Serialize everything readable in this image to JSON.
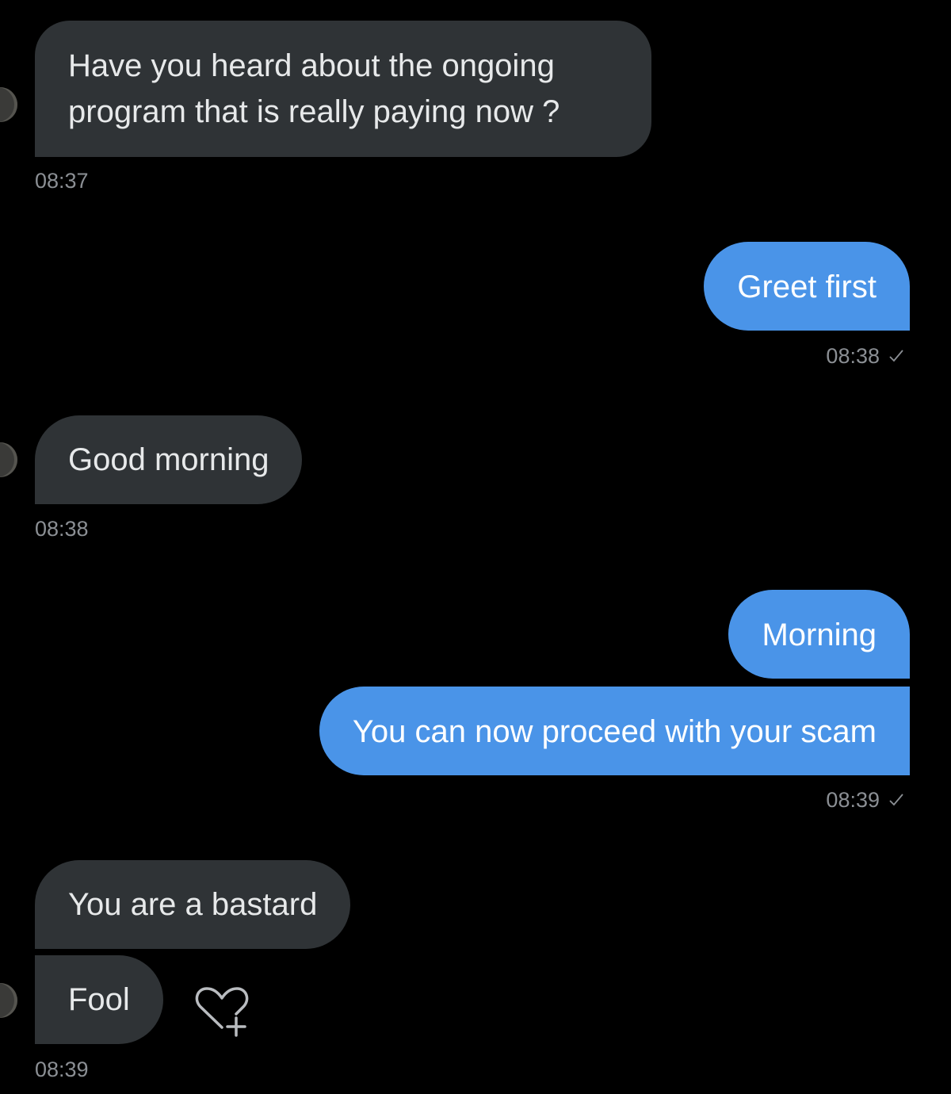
{
  "conversation": {
    "messages": [
      {
        "id": "m1",
        "direction": "incoming",
        "lines": [
          "Have you heard about the ongoing",
          "program that is really paying now ?"
        ]
      },
      {
        "id": "m2",
        "direction": "outgoing",
        "text": "Greet first"
      },
      {
        "id": "m3",
        "direction": "incoming",
        "text": "Good morning"
      },
      {
        "id": "m4",
        "direction": "outgoing",
        "text": "Morning"
      },
      {
        "id": "m5",
        "direction": "outgoing",
        "text": "You can now proceed with your scam"
      },
      {
        "id": "m6",
        "direction": "incoming",
        "text": "You are a bastard"
      },
      {
        "id": "m7",
        "direction": "incoming",
        "text": "Fool"
      }
    ],
    "timestamps": {
      "t1": "08:37",
      "t2": "08:38",
      "t3": "08:38",
      "t4": "08:39",
      "t5": "08:39"
    },
    "read_receipt_icon": "check-icon",
    "reaction_icon": "add-reaction-heart-icon"
  },
  "colors": {
    "background": "#000000",
    "incoming_bubble": "#2f3336",
    "outgoing_bubble": "#4a94e8",
    "timestamp": "#8b8f94"
  }
}
